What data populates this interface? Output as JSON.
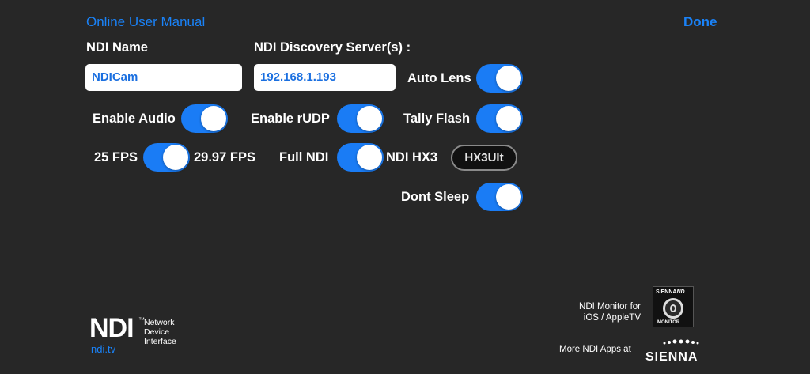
{
  "header": {
    "manual_link": "Online User Manual",
    "done_label": "Done"
  },
  "ndi_name": {
    "label": "NDI Name",
    "value": "NDICam"
  },
  "discovery": {
    "label": "NDI Discovery Server(s) :",
    "value": "192.168.1.193"
  },
  "toggles": {
    "auto_lens": {
      "label": "Auto Lens",
      "on": true
    },
    "enable_audio": {
      "label": "Enable Audio",
      "on": true
    },
    "enable_rudp": {
      "label": "Enable rUDP",
      "on": true
    },
    "tally_flash": {
      "label": "Tally Flash",
      "on": true
    },
    "fps": {
      "left_label": "25 FPS",
      "right_label": "29.97 FPS",
      "on": true
    },
    "ndi_mode": {
      "left_label": "Full NDI",
      "right_label": "NDI HX3",
      "on": true
    },
    "dont_sleep": {
      "label": "Dont Sleep",
      "on": true
    }
  },
  "hx_button": {
    "label": "HX3Ult"
  },
  "footer": {
    "ndi_logo": "NDI",
    "ndi_logo_tm": "™",
    "ndi_sub": [
      "Network",
      "Device",
      "Interface"
    ],
    "ndi_link": "ndi.tv",
    "monitor_text": [
      "NDI Monitor for",
      "iOS / AppleTV"
    ],
    "monitor_icon_top": "SIENNA",
    "monitor_icon_top_b": "ND",
    "monitor_icon_bottom": "MONITOR",
    "more_apps": "More NDI Apps at",
    "sienna_logo": "SIENNA"
  },
  "colors": {
    "background": "#272727",
    "accent": "#1a7cf5",
    "link": "#1a82f7"
  }
}
